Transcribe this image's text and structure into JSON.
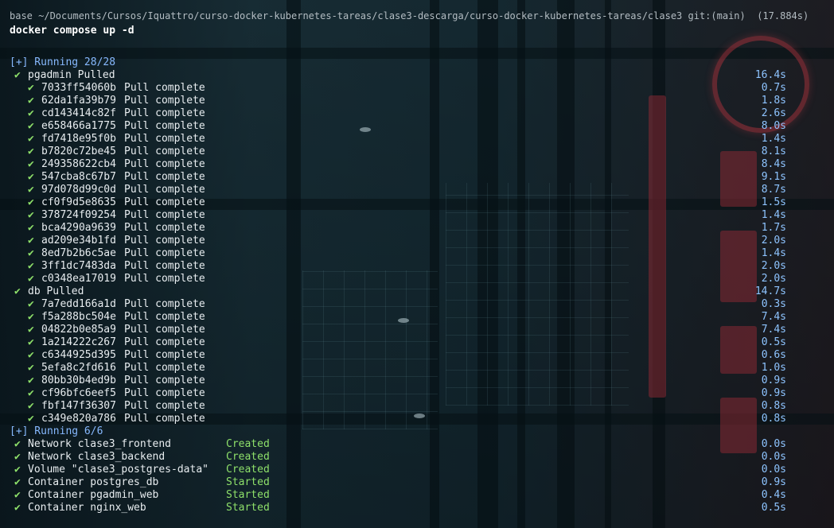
{
  "prompt": "base ~/Documents/Cursos/Iquattro/curso-docker-kubernetes-tareas/clase3-descarga/curso-docker-kubernetes-tareas/clase3 git:(main)  (17.884s)",
  "command": "docker compose up -d",
  "check_glyph": "✔",
  "pull": {
    "header": "[+] Running 28/28",
    "services": [
      {
        "name": "pgadmin Pulled",
        "time": "16.4s",
        "layers": [
          {
            "id": "7033ff54060b",
            "status": "Pull complete",
            "time": "0.7s"
          },
          {
            "id": "62da1fa39b79",
            "status": "Pull complete",
            "time": "1.8s"
          },
          {
            "id": "cd143414c82f",
            "status": "Pull complete",
            "time": "2.6s"
          },
          {
            "id": "e658466a1775",
            "status": "Pull complete",
            "time": "8.0s"
          },
          {
            "id": "fd7418e95f0b",
            "status": "Pull complete",
            "time": "1.4s"
          },
          {
            "id": "b7820c72be45",
            "status": "Pull complete",
            "time": "8.1s"
          },
          {
            "id": "249358622cb4",
            "status": "Pull complete",
            "time": "8.4s"
          },
          {
            "id": "547cba8c67b7",
            "status": "Pull complete",
            "time": "9.1s"
          },
          {
            "id": "97d078d99c0d",
            "status": "Pull complete",
            "time": "8.7s"
          },
          {
            "id": "cf0f9d5e8635",
            "status": "Pull complete",
            "time": "1.5s"
          },
          {
            "id": "378724f09254",
            "status": "Pull complete",
            "time": "1.4s"
          },
          {
            "id": "bca4290a9639",
            "status": "Pull complete",
            "time": "1.7s"
          },
          {
            "id": "ad209e34b1fd",
            "status": "Pull complete",
            "time": "2.0s"
          },
          {
            "id": "8ed7b2b6c5ae",
            "status": "Pull complete",
            "time": "1.4s"
          },
          {
            "id": "3ff1dc7483da",
            "status": "Pull complete",
            "time": "2.0s"
          },
          {
            "id": "c0348ea17019",
            "status": "Pull complete",
            "time": "2.0s"
          }
        ]
      },
      {
        "name": "db Pulled",
        "time": "14.7s",
        "layers": [
          {
            "id": "7a7edd166a1d",
            "status": "Pull complete",
            "time": "0.3s"
          },
          {
            "id": "f5a288bc504e",
            "status": "Pull complete",
            "time": "7.4s"
          },
          {
            "id": "04822b0e85a9",
            "status": "Pull complete",
            "time": "7.4s"
          },
          {
            "id": "1a214222c267",
            "status": "Pull complete",
            "time": "0.5s"
          },
          {
            "id": "c6344925d395",
            "status": "Pull complete",
            "time": "0.6s"
          },
          {
            "id": "5efa8c2fd616",
            "status": "Pull complete",
            "time": "1.0s"
          },
          {
            "id": "80bb30b4ed9b",
            "status": "Pull complete",
            "time": "0.9s"
          },
          {
            "id": "cf96bfc6eef5",
            "status": "Pull complete",
            "time": "0.9s"
          },
          {
            "id": "fbf147f36307",
            "status": "Pull complete",
            "time": "0.8s"
          },
          {
            "id": "c349e820a786",
            "status": "Pull complete",
            "time": "0.8s"
          }
        ]
      }
    ]
  },
  "run": {
    "header": "[+] Running 6/6",
    "resources": [
      {
        "name": "Network clase3_frontend",
        "status": "Created",
        "time": "0.0s"
      },
      {
        "name": "Network clase3_backend",
        "status": "Created",
        "time": "0.0s"
      },
      {
        "name": "Volume \"clase3_postgres-data\"",
        "status": "Created",
        "time": "0.0s"
      },
      {
        "name": "Container postgres_db",
        "status": "Started",
        "time": "0.9s"
      },
      {
        "name": "Container pgadmin_web",
        "status": "Started",
        "time": "0.4s"
      },
      {
        "name": "Container nginx_web",
        "status": "Started",
        "time": "0.5s"
      }
    ]
  },
  "colors": {
    "check": "#8ee06a",
    "header": "#87b9ff",
    "time": "#8ec4ff",
    "status": "#8ee06a",
    "text": "#e8edf0"
  }
}
